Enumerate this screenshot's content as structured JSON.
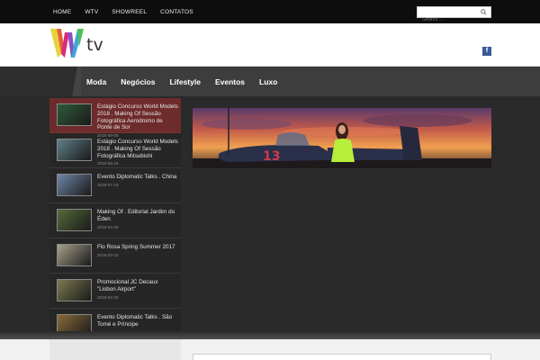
{
  "topbar": {
    "nav": [
      "HOME",
      "WTV",
      "SHOWREEL",
      "CONTATOS"
    ],
    "search_placeholder": "Search ..."
  },
  "header": {
    "logo_text": "tv",
    "facebook_label": "f"
  },
  "mainnav": {
    "items": [
      "Moda",
      "Negócios",
      "Lifestyle",
      "Eventos",
      "Luxo"
    ]
  },
  "sidebar": {
    "items": [
      {
        "title": "Estágio Concurso World Models 2018 . Making Of Sessão Fotográfica Aerodromo de Ponte de Sor",
        "date": "2018-09-09",
        "thumb_color": "#2e5a3a",
        "active": true
      },
      {
        "title": "Estágio Concurso World Models 2018 . Making Of Sessão Fotográfica Mitsubishi",
        "date": "2018-08-18",
        "thumb_color": "#5f7f88"
      },
      {
        "title": "Evento Diplomatic Talks . China",
        "date": "2018-07-19",
        "thumb_color": "#6f86a6"
      },
      {
        "title": "Making Of . Editorial Jardim do Éden",
        "date": "2018-04-29",
        "thumb_color": "#546b3a"
      },
      {
        "title": "Flo Rosa Spring Summer 2017",
        "date": "2018-03-23",
        "thumb_color": "#a8a08c"
      },
      {
        "title": "Promocional JC Decaux \"Lisbon Airport\"",
        "date": "2018-02-20",
        "thumb_color": "#7c7a52"
      },
      {
        "title": "Evento Diplomatic Talks . São Tomé e Príncipe",
        "date": "2018-01-13",
        "thumb_color": "#8a6a3a"
      }
    ],
    "arrow": "▼"
  },
  "colors": {
    "accent": "#6e2b2b",
    "topbar": "#0d0d0d",
    "nav": "#3d3d3d",
    "facebook": "#3b5998"
  }
}
